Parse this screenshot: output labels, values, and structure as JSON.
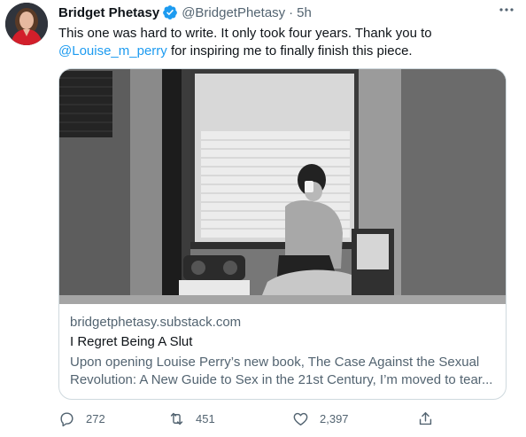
{
  "author": {
    "name": "Bridget Phetasy",
    "handle": "@BridgetPhetasy",
    "separator": "·",
    "time": "5h"
  },
  "tweet": {
    "text_line1": "This one was hard to write. It only took four years. Thank you to",
    "mention": "@Louise_m_perry",
    "text_line2_rest": " for inspiring me to finally finish this piece."
  },
  "card": {
    "domain": "bridgetphetasy.substack.com",
    "title": "I Regret Being A Slut",
    "description_line1": "Upon opening Louise Perry’s new book, The Case Against the Sexual",
    "description_line2": "Revolution: A New Guide to Sex in the 21st Century, I’m moved to tear..."
  },
  "actions": {
    "replies": "272",
    "retweets": "451",
    "likes": "2,397"
  },
  "colors": {
    "accent": "#1d9bf0",
    "secondary_text": "#536471",
    "border": "#cfd9de"
  },
  "icons": [
    "verified-badge-icon",
    "more-options-icon",
    "reply-icon",
    "retweet-icon",
    "like-icon",
    "share-icon"
  ]
}
